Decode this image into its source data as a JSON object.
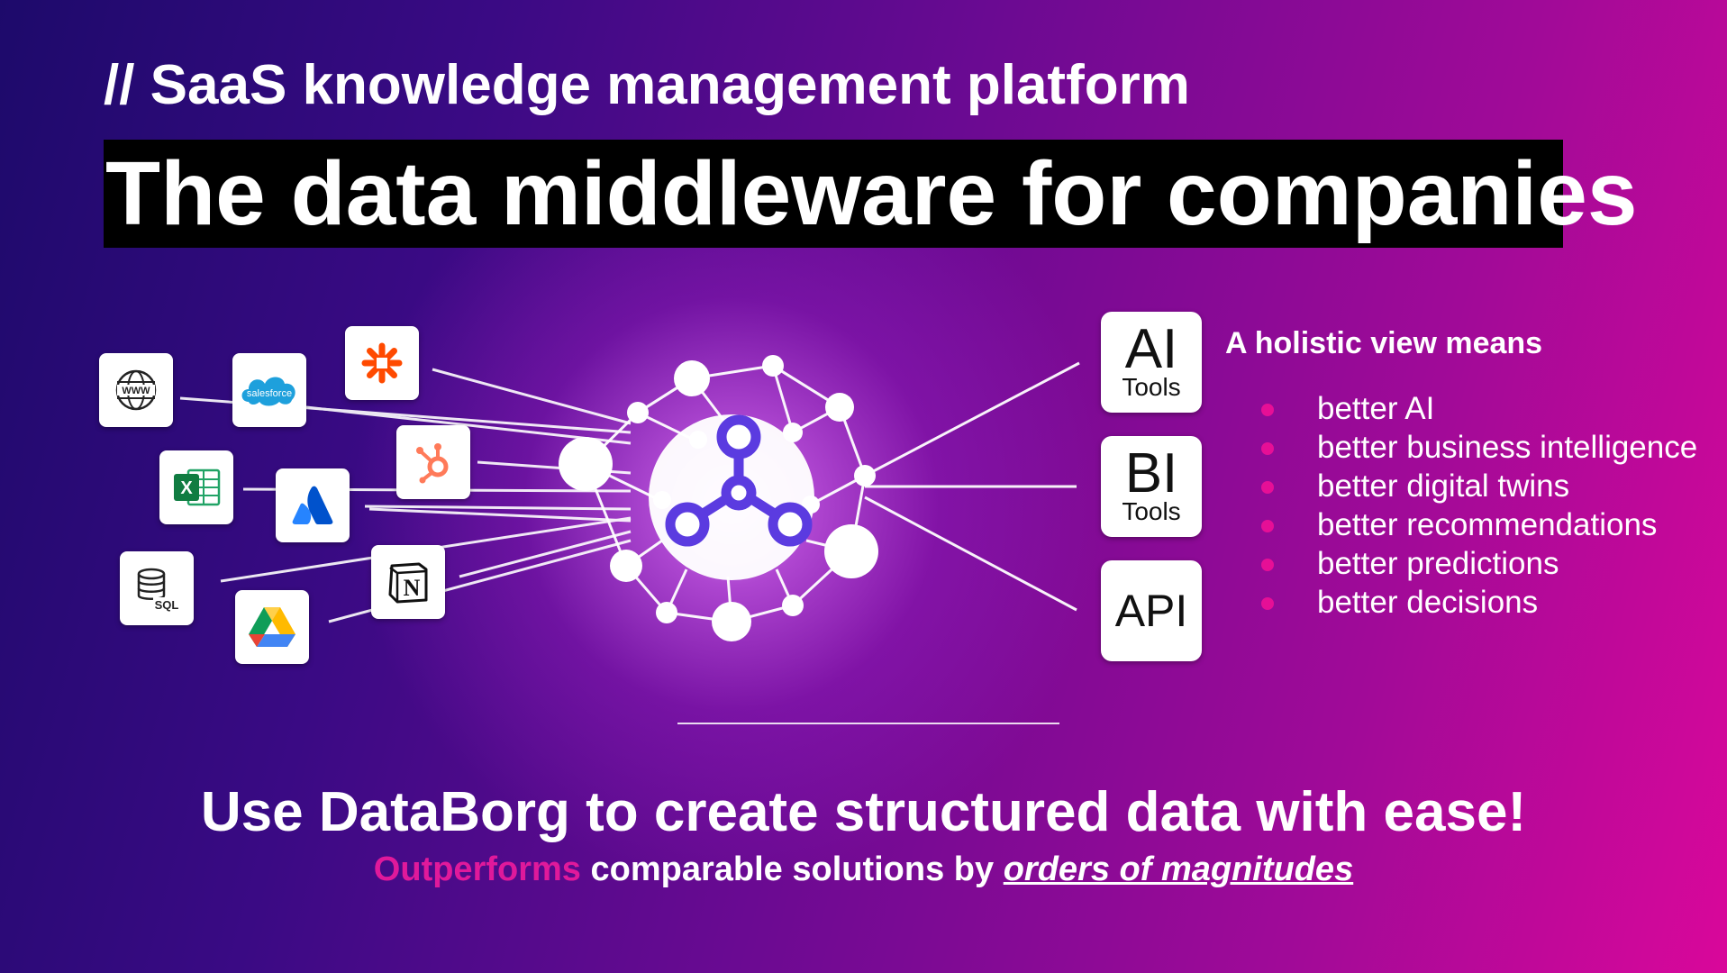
{
  "header": {
    "subtitle": "// SaaS knowledge management platform",
    "title": "The data middleware for companies"
  },
  "sources": [
    {
      "name": "www-icon",
      "label": "WWW"
    },
    {
      "name": "salesforce-icon",
      "label": "salesforce"
    },
    {
      "name": "zapier-icon"
    },
    {
      "name": "hubspot-icon"
    },
    {
      "name": "excel-icon",
      "label": "X"
    },
    {
      "name": "atlassian-icon"
    },
    {
      "name": "sql-database-icon",
      "label": "SQL"
    },
    {
      "name": "notion-icon",
      "label": "N"
    },
    {
      "name": "google-drive-icon"
    }
  ],
  "outputs": {
    "ai": {
      "big": "AI",
      "small": "Tools"
    },
    "bi": {
      "big": "BI",
      "small": "Tools"
    },
    "api": {
      "big": "API"
    }
  },
  "benefits": {
    "heading": "A holistic view means",
    "items": [
      "better AI",
      "better business intelligence",
      "better digital twins",
      "better recommendations",
      "better predictions",
      "better decisions"
    ]
  },
  "footer": {
    "cta": "Use DataBorg to create structured data with ease!",
    "tagline_highlight": "Outperforms",
    "tagline_middle": " comparable solutions by ",
    "tagline_emphasis": "orders of magnitudes"
  },
  "colors": {
    "accent": "#e0199b",
    "bullet": "#e60f96",
    "hub_icon": "#5b3be0"
  }
}
